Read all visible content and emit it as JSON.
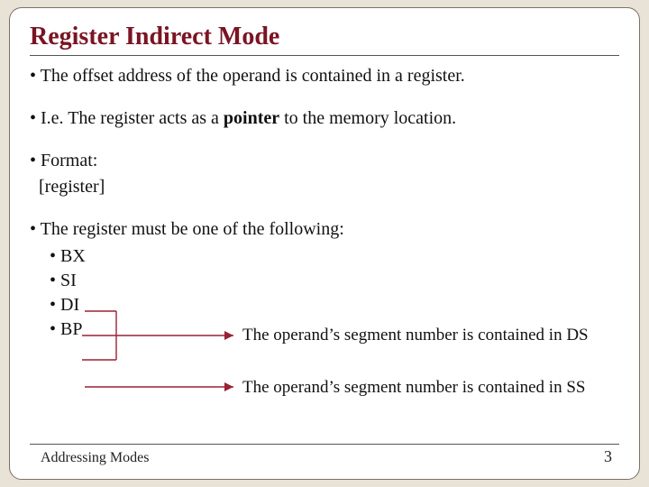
{
  "title": "Register Indirect Mode",
  "bullets": {
    "b1": "The offset address of the operand is contained in a register.",
    "b2_pre": "I.e. The register acts as a ",
    "b2_bold": "pointer",
    "b2_post": " to the memory location.",
    "b3": "Format:",
    "b3_line2": "[register]",
    "b4": "The register must be one of the following:",
    "reg1": "BX",
    "reg2": "SI",
    "reg3": "DI",
    "reg4": "BP"
  },
  "callouts": {
    "ds": "The operand’s segment number is contained in DS",
    "ss": "The operand’s segment number is contained in SS"
  },
  "footer": {
    "left": "Addressing Modes",
    "pageno": "3"
  },
  "colors": {
    "title": "#7a1423",
    "arrow": "#992233"
  }
}
